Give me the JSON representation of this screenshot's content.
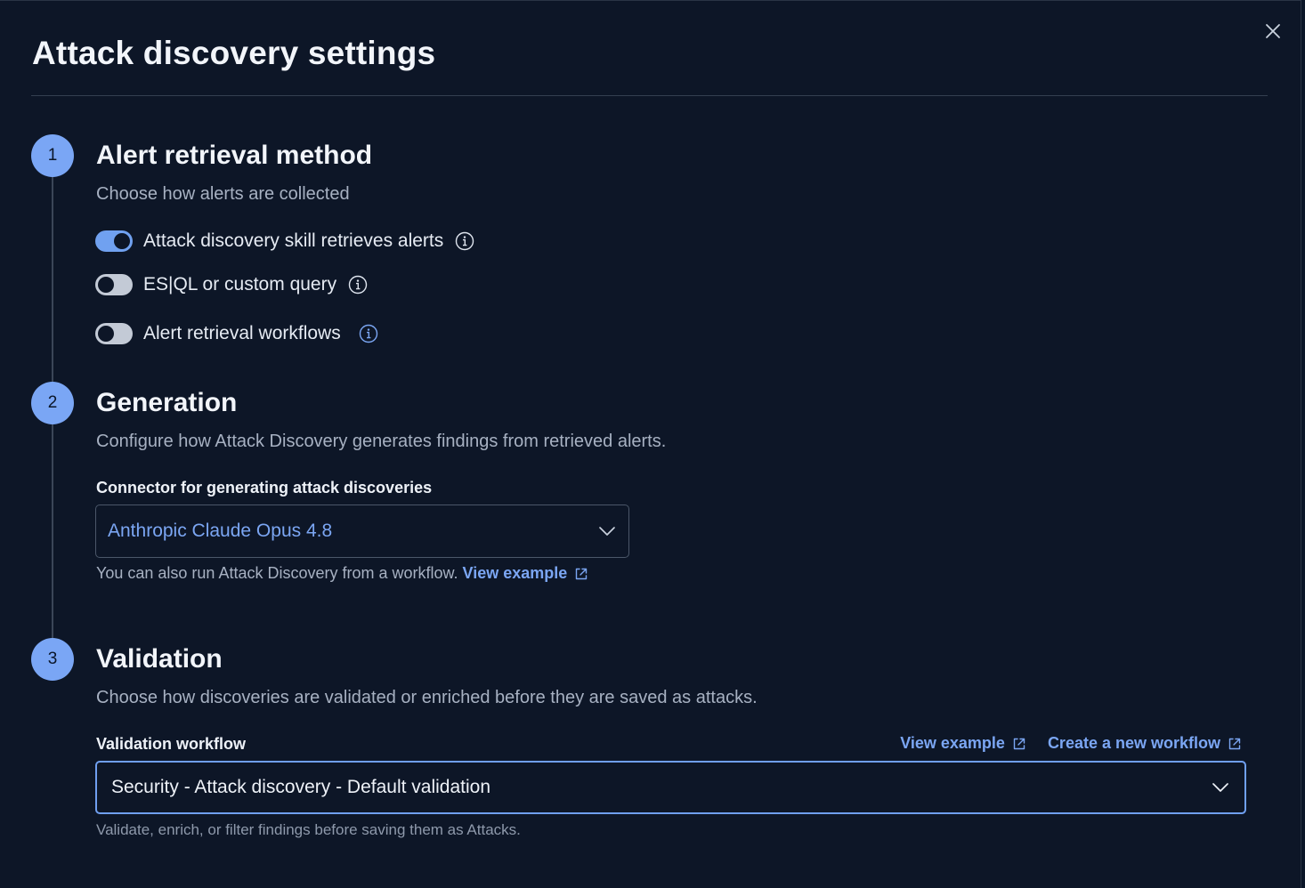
{
  "flyout": {
    "title": "Attack discovery settings",
    "close_icon": "close-icon"
  },
  "steps": [
    {
      "number": "1",
      "title": "Alert retrieval method",
      "description": "Choose how alerts are collected",
      "toggles": [
        {
          "label": "Attack discovery skill retrieves alerts",
          "checked": true,
          "icon": "info-icon"
        },
        {
          "label": "ES|QL or custom query",
          "checked": false,
          "icon": "info-icon"
        },
        {
          "label": "Alert retrieval workflows",
          "checked": false,
          "icon": "info-icon",
          "icon_color": "#7ba6f3"
        }
      ]
    },
    {
      "number": "2",
      "title": "Generation",
      "description": "Configure how Attack Discovery generates findings from retrieved alerts.",
      "connector_label": "Connector for generating attack discoveries",
      "connector_value": "Anthropic Claude Opus 4.8",
      "help_text": "You can also run Attack Discovery from a workflow.",
      "help_link": "View example"
    },
    {
      "number": "3",
      "title": "Validation",
      "description": "Choose how discoveries are validated or enriched before they are saved as attacks.",
      "workflow_label": "Validation workflow",
      "view_example_link": "View example",
      "create_workflow_link": "Create a new workflow",
      "workflow_value": "Security - Attack discovery - Default validation",
      "help_text": "Validate, enrich, or filter findings before saving them as Attacks."
    }
  ],
  "colors": {
    "background": "#0d1627",
    "accent": "#7aa6f5",
    "link": "#7ba6f3",
    "muted_text": "#a7b1c2"
  }
}
